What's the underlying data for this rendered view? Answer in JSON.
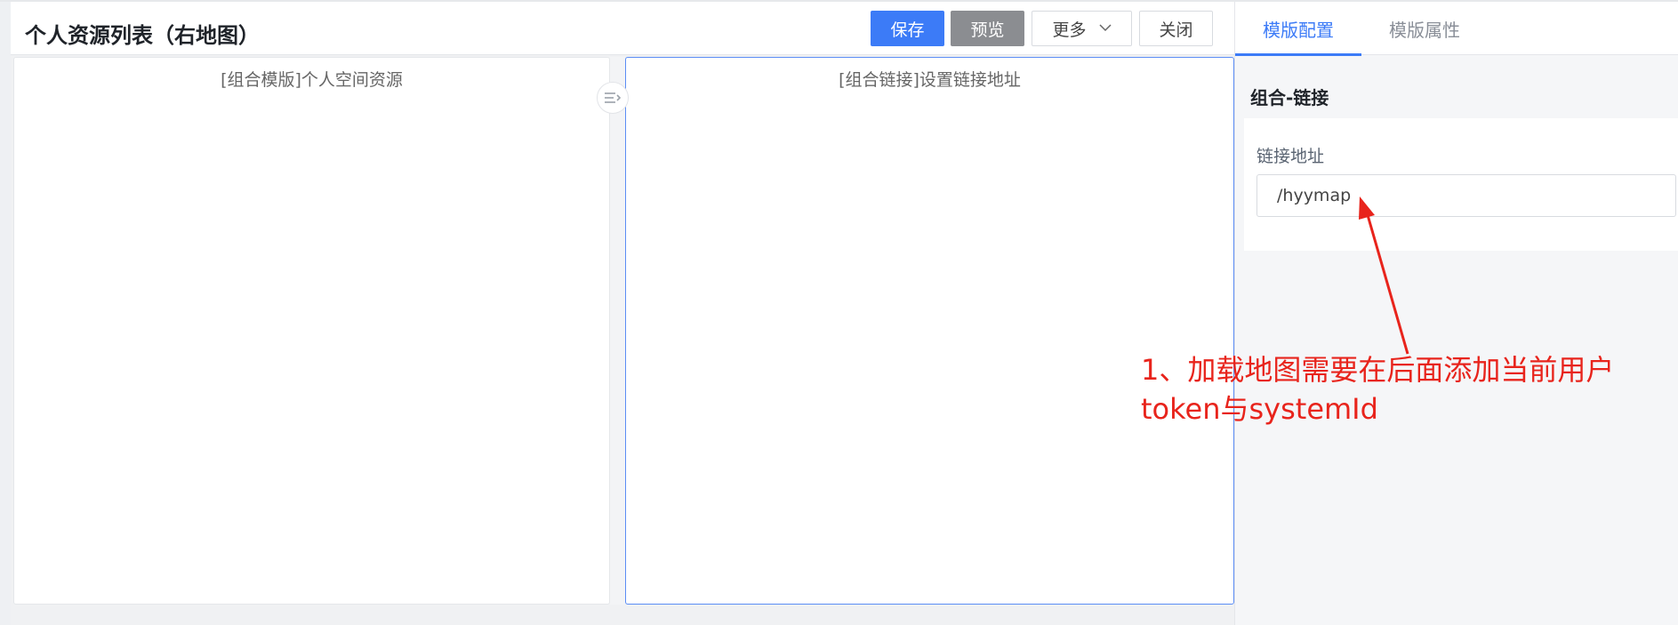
{
  "header": {
    "title": "个人资源列表（右地图）",
    "buttons": {
      "save": "保存",
      "preview": "预览",
      "more": "更多",
      "close": "关闭"
    }
  },
  "canvas": {
    "left_panel_title": "[组合模版]个人空间资源",
    "right_panel_title": "[组合链接]设置链接地址"
  },
  "sidebar": {
    "tabs": [
      "模版配置",
      "模版属性"
    ],
    "active_tab": "模版配置",
    "section_title": "组合-链接",
    "field_label": "链接地址",
    "field_value": "/hyymap"
  },
  "annotation": {
    "line1": "1、加载地图需要在后面添加当前用户",
    "line2": "token与systemId",
    "color": "#e8241c"
  },
  "colors": {
    "primary": "#3c7bf7",
    "preview_button": "#8b8d91"
  }
}
